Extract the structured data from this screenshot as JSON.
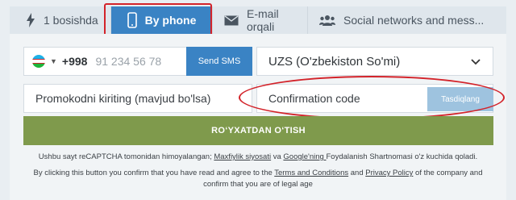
{
  "tabs": [
    {
      "label": "1 bosishda",
      "icon": "lightning-icon"
    },
    {
      "label": "By phone",
      "icon": "phone-icon"
    },
    {
      "label": "E-mail orqali",
      "icon": "envelope-icon"
    },
    {
      "label": "Social networks and mess...",
      "icon": "users-icon"
    }
  ],
  "phone": {
    "prefix": "+998",
    "placeholder": "91 234 56 78",
    "send_label": "Send SMS"
  },
  "currency": {
    "value": "UZS (O'zbekiston So'mi)"
  },
  "promo": {
    "placeholder": "Promokodni kiriting (mavjud bo'lsa)"
  },
  "confirmation": {
    "placeholder": "Confirmation code",
    "button_label": "Tasdiqlang"
  },
  "register": {
    "label": "RO‘YXATDAN O‘TISH"
  },
  "recaptcha_notice": {
    "before": "Ushbu sayt reCAPTCHA tomonidan himoyalangan; ",
    "link1": "Maxfiylik siyosati",
    "mid": " va ",
    "link2": "Google'ning ",
    "after": "Foydalanish Shartnomasi o'z kuchida qoladi."
  },
  "terms_notice": {
    "before": "By clicking this button you confirm that you have read and agree to the ",
    "link1": "Terms and Conditions",
    "mid": " and ",
    "link2": "Privacy Policy",
    "after": " of the company and confirm that you are of legal age"
  },
  "colors": {
    "accent": "#3a83c4",
    "register": "#7f9a4c",
    "highlight": "#d3232a",
    "confirm_disabled": "#9ec3df"
  }
}
